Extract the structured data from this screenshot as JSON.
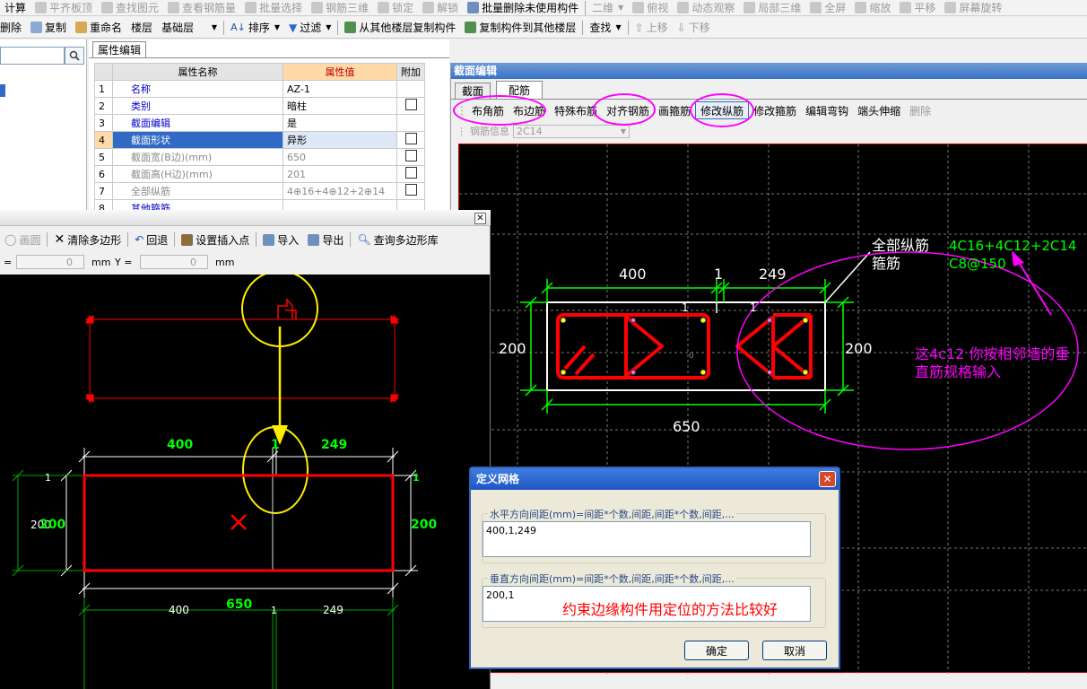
{
  "toolbar_top": {
    "items": [
      {
        "label": "计算",
        "icon": "calculate-icon"
      },
      {
        "label": "平齐板顶",
        "icon": "align-top-icon"
      },
      {
        "label": "查找图元",
        "icon": "find-element-icon"
      },
      {
        "label": "查看钢筋量",
        "icon": "view-rebar-icon"
      },
      {
        "label": "批量选择",
        "icon": "batch-select-icon"
      },
      {
        "label": "钢筋三维",
        "icon": "rebar-3d-icon"
      },
      {
        "label": "锁定",
        "icon": "lock-icon"
      },
      {
        "label": "解锁",
        "icon": "unlock-icon"
      },
      {
        "label": "批量删除未使用构件",
        "icon": "batch-delete-icon"
      },
      {
        "label": "二维",
        "icon": "2d-icon"
      },
      {
        "label": "俯视",
        "icon": "top-view-icon"
      },
      {
        "label": "动态观察",
        "icon": "orbit-icon"
      },
      {
        "label": "局部三维",
        "icon": "local-3d-icon"
      },
      {
        "label": "全屏",
        "icon": "fullscreen-icon"
      },
      {
        "label": "缩放",
        "icon": "zoom-icon"
      },
      {
        "label": "平移",
        "icon": "pan-icon"
      },
      {
        "label": "屏幕旋转",
        "icon": "rotate-icon"
      }
    ]
  },
  "toolbar_second": {
    "delete_label": "删除",
    "copy_label": "复制",
    "rename_label": "重命名",
    "floor_label": "楼层",
    "floor_value": "基础层",
    "sort_label": "排序",
    "filter_label": "过滤",
    "copy_from_label": "从其他楼层复制构件",
    "copy_to_label": "复制构件到其他楼层",
    "find_label": "查找",
    "move_up_label": "上移",
    "move_down_label": "下移"
  },
  "property_panel": {
    "tab_label": "属性编辑",
    "headers": {
      "name": "属性名称",
      "value": "属性值",
      "extra": "附加"
    },
    "rows": [
      {
        "num": "1",
        "name": "名称",
        "value": "AZ-1",
        "check": false
      },
      {
        "num": "2",
        "name": "类别",
        "value": "暗柱",
        "check": true
      },
      {
        "num": "3",
        "name": "截面编辑",
        "value": "是",
        "check": false
      },
      {
        "num": "4",
        "name": "截面形状",
        "value": "异形",
        "check": true
      },
      {
        "num": "5",
        "name": "截面宽(B边)(mm)",
        "value": "650",
        "check": true
      },
      {
        "num": "6",
        "name": "截面高(H边)(mm)",
        "value": "201",
        "check": true
      },
      {
        "num": "7",
        "name": "全部纵筋",
        "value": "4⊕16+4⊕12+2⊕14",
        "check": true
      },
      {
        "num": "8",
        "name": "其他箍筋",
        "value": "",
        "check": false
      }
    ]
  },
  "section_editor": {
    "title": "截面编辑",
    "tabs": [
      "截面",
      "配筋"
    ],
    "tools": [
      "布角筋",
      "布边筋",
      "特殊布筋",
      "对齐钢筋",
      "画箍筋",
      "修改纵筋",
      "修改箍筋",
      "编辑弯钩",
      "端头伸缩",
      "删除"
    ],
    "rebar_info_label": "钢筋信息",
    "rebar_info_value": "2C14",
    "canvas": {
      "dim_top_1": "400",
      "dim_top_2": "1",
      "dim_top_3": "249",
      "dim_left": "200",
      "dim_right": "200",
      "dim_bottom": "650",
      "small_1a": "1",
      "small_1b": "1",
      "center_mark": "0",
      "label_all_rebar": "全部纵筋",
      "label_stirrup": "箍筋",
      "value_all_rebar": "4C16+4C12+2C14",
      "value_stirrup": "C8@150"
    },
    "annotation": "这4c12 你按相邻墙的垂直筋规格输入"
  },
  "polygon_editor": {
    "tools": [
      "画圆",
      "清除多边形",
      "回退",
      "设置插入点",
      "导入",
      "导出",
      "查询多边形库"
    ],
    "x_label": "=",
    "x_value": "0",
    "x_unit": "mm",
    "y_label": "Y =",
    "y_value": "0",
    "y_unit": "mm",
    "canvas": {
      "top_1": "400",
      "top_2": "1",
      "top_3": "249",
      "left_small": "1",
      "left_2": "200",
      "left_1": "200",
      "right_small": "1",
      "right_1": "200",
      "bottom_total": "650",
      "bottom_1": "400",
      "bottom_2": "1",
      "bottom_3": "249"
    }
  },
  "grid_dialog": {
    "title": "定义网格",
    "h_label": "水平方向间距(mm)=间距*个数,间距,间距*个数,间距,...",
    "h_value": "400,1,249",
    "v_label": "垂直方向间距(mm)=间距*个数,间距,间距*个数,间距,...",
    "v_value": "200,1",
    "annotation": "约束边缘构件用定位的方法比较好",
    "ok_label": "确定",
    "cancel_label": "取消"
  },
  "colors": {
    "highlight_magenta": "#ff00ff",
    "circle_yellow": "#ffee00",
    "rebar_red": "#ff0000",
    "dim_green": "#00ff00",
    "title_blue": "#3a72c6"
  }
}
